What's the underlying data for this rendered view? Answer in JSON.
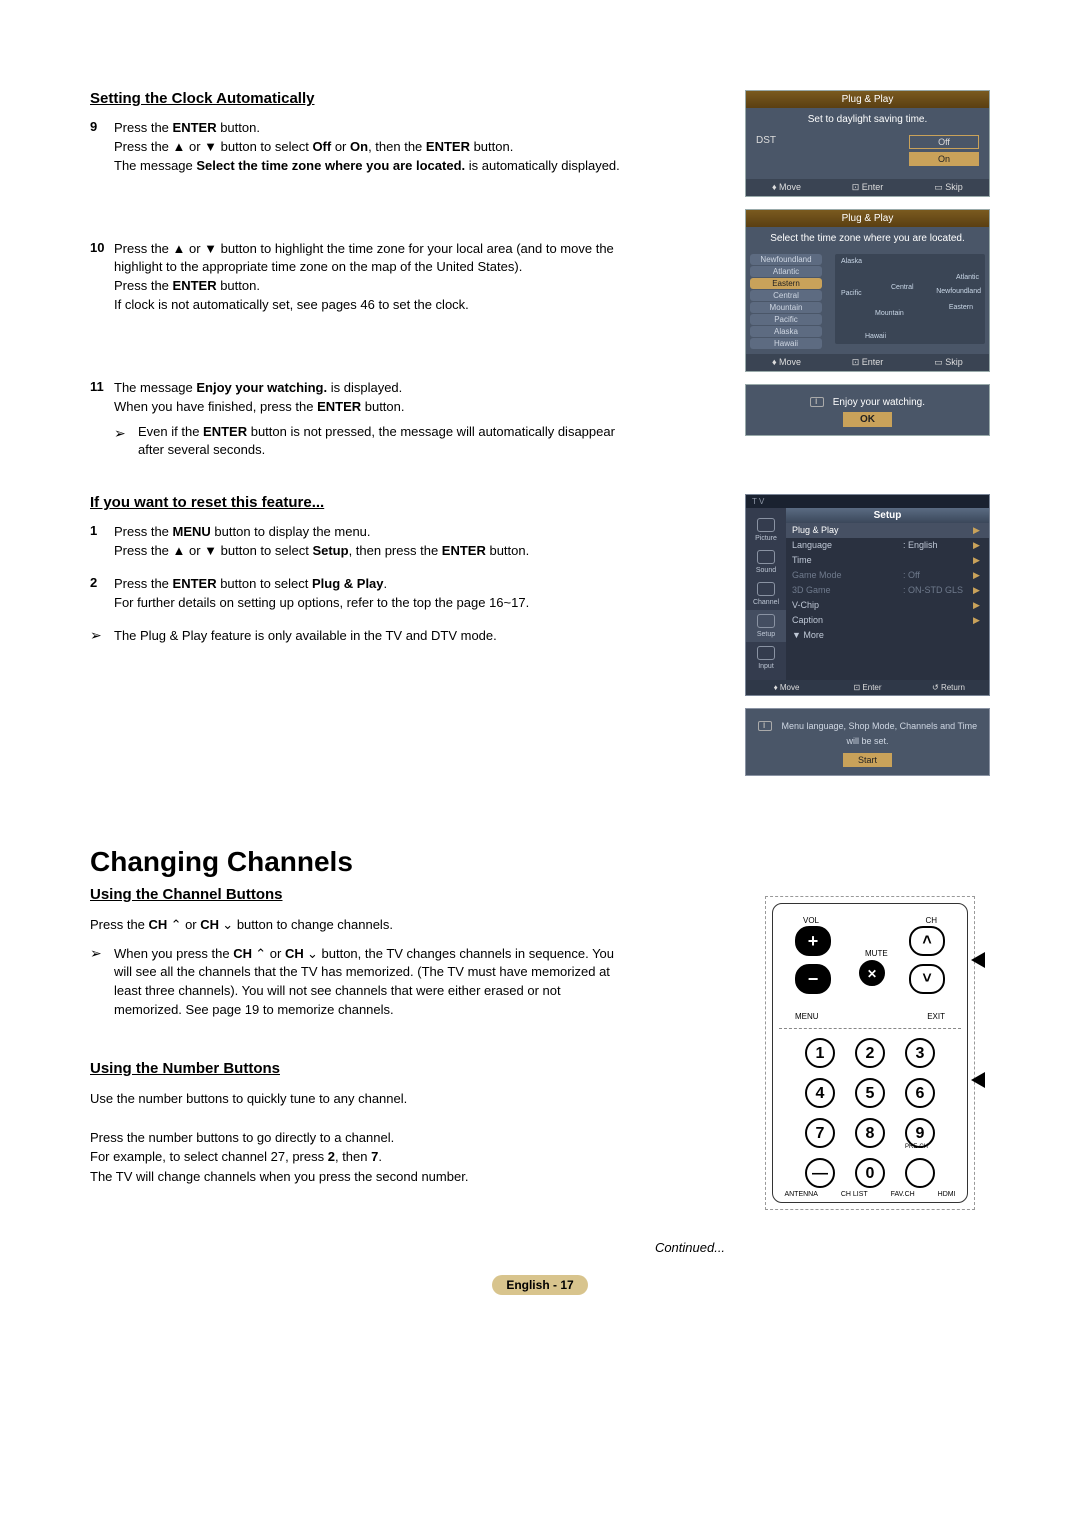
{
  "sections": {
    "clock_heading": "Setting the Clock Automatically",
    "reset_heading": "If you want to reset this feature...",
    "changing_heading": "Changing Channels",
    "channel_sub": "Using the Channel Buttons",
    "number_sub": "Using the Number Buttons"
  },
  "steps": {
    "s9": {
      "num": "9",
      "l1a": "Press the ",
      "l1b": "ENTER",
      "l1c": " button.",
      "l2a": "Press the ▲ or ▼ button to select ",
      "l2off": "Off",
      "l2or": " or ",
      "l2on": "On",
      "l2then": ", then the ",
      "l2enter": "ENTER",
      "l2btn": " button.",
      "l3a": "The message ",
      "l3b": "Select the time zone where you are located.",
      "l3c": " is automatically displayed."
    },
    "s10": {
      "num": "10",
      "l1": "Press the ▲ or ▼ button to highlight the time zone for your local area (and to move the highlight to the appropriate time zone on the map of the United States).",
      "l2a": "Press the ",
      "l2b": "ENTER",
      "l2c": " button.",
      "l3": "If clock is not automatically set, see pages 46 to set the clock."
    },
    "s11": {
      "num": "11",
      "l1a": "The message ",
      "l1b": "Enjoy your watching.",
      "l1c": " is displayed.",
      "l2a": "When you have finished, press the ",
      "l2b": "ENTER",
      "l2c": " button.",
      "note_a": "Even if the ",
      "note_b": "ENTER",
      "note_c": " button is not pressed, the message will automatically disappear after several seconds."
    },
    "r1": {
      "num": "1",
      "l1a": "Press the ",
      "l1b": "MENU",
      "l1c": " button to display the menu.",
      "l2a": "Press the ▲ or ▼ button to select ",
      "l2b": "Setup",
      "l2c": ", then press the ",
      "l2d": "ENTER",
      "l2e": " button."
    },
    "r2": {
      "num": "2",
      "l1a": "Press the ",
      "l1b": "ENTER",
      "l1c": " button to select ",
      "l1d": "Plug & Play",
      "l1e": ".",
      "l2": "For further details on setting up options, refer to the top the page 16~17."
    },
    "rnote": "The Plug & Play feature is only available in the TV and DTV mode."
  },
  "channel": {
    "l1a": "Press the ",
    "l1b": "CH",
    "l1up": " ",
    "l1or": " or ",
    "l1c": "CH",
    "l1dn": " ",
    "l1d": " button to change channels.",
    "note_a": "When you press the ",
    "note_b": "CH",
    "note_or": " or ",
    "note_c": "CH",
    "note_d": " button, the TV changes channels in sequence. You will see all the channels that the TV has memorized. (The TV must have memorized at least three channels). You will not see channels that were either erased or not memorized. See page 19 to memorize channels."
  },
  "number_section": {
    "l1": "Use the number buttons to quickly tune to any channel.",
    "l2": "Press the number buttons to go directly to a channel.",
    "l3a": "For example, to select channel 27, press ",
    "l3b": "2",
    "l3c": ", then ",
    "l3d": "7",
    "l3e": ".",
    "l4": "The TV will change channels when you press the second number."
  },
  "continued": "Continued...",
  "page_label": "English - 17",
  "osd1": {
    "title": "Plug & Play",
    "msg": "Set to daylight saving time.",
    "label": "DST",
    "opt_off": "Off",
    "opt_on": "On",
    "move": "Move",
    "enter": "Enter",
    "skip": "Skip"
  },
  "osd2": {
    "title": "Plug & Play",
    "msg": "Select the time zone where you are located.",
    "tz": [
      "Newfoundland",
      "Atlantic",
      "Eastern",
      "Central",
      "Mountain",
      "Pacific",
      "Alaska",
      "Hawaii"
    ],
    "map_labels": [
      "Alaska",
      "Pacific",
      "Central",
      "Atlantic",
      "Newfoundland",
      "Mountain",
      "Eastern",
      "Hawaii"
    ],
    "move": "Move",
    "enter": "Enter",
    "skip": "Skip"
  },
  "osd3": {
    "msg": "Enjoy your watching.",
    "ok": "OK"
  },
  "setup_menu": {
    "tv": "T V",
    "title": "Setup",
    "side": [
      "Picture",
      "Sound",
      "Channel",
      "Setup",
      "Input"
    ],
    "rows": [
      {
        "label": "Plug & Play",
        "val": "",
        "arrow": "▶",
        "hi": true
      },
      {
        "label": "Language",
        "val": ": English",
        "arrow": "▶"
      },
      {
        "label": "Time",
        "val": "",
        "arrow": "▶"
      },
      {
        "label": "Game Mode",
        "val": ": Off",
        "arrow": "▶",
        "dim": true
      },
      {
        "label": "3D Game",
        "val": ": ON-STD GLS",
        "arrow": "▶",
        "dim": true
      },
      {
        "label": "V-Chip",
        "val": "",
        "arrow": "▶"
      },
      {
        "label": "Caption",
        "val": "",
        "arrow": "▶"
      },
      {
        "label": "▼ More",
        "val": "",
        "arrow": ""
      }
    ],
    "hints": {
      "move": "Move",
      "enter": "Enter",
      "return": "Return"
    }
  },
  "info_bubble": {
    "msg": "Menu language, Shop Mode, Channels and Time will be set.",
    "start": "Start"
  },
  "remote": {
    "vol": "VOL",
    "ch": "CH",
    "mute": "MUTE",
    "menu": "MENU",
    "exit": "EXIT",
    "n1": "1",
    "n2": "2",
    "n3": "3",
    "n4": "4",
    "n5": "5",
    "n6": "6",
    "n7": "7",
    "n8": "8",
    "n9": "9",
    "n0": "0",
    "ndash": "—",
    "prech": "PRE-CH",
    "bottom": [
      "ANTENNA",
      "CH LIST",
      "FAV.CH",
      "HDMI"
    ]
  },
  "arrow": "➢"
}
